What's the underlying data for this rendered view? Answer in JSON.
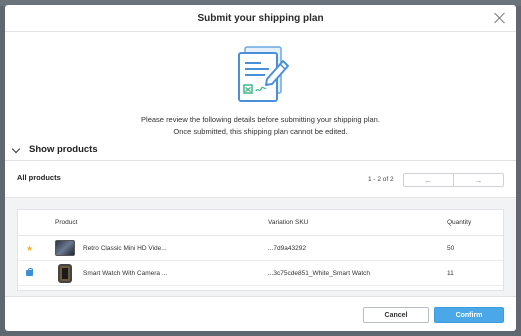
{
  "modal": {
    "title": "Submit your shipping plan",
    "intro_line1": "Please review the following details before submitting your shipping plan.",
    "intro_line2": "Once submitted, this shipping plan cannot be edited."
  },
  "section": {
    "toggle_label": "Show products"
  },
  "products": {
    "heading": "All products",
    "range": "1 - 2 of 2",
    "prev_icon": "arrow-left",
    "next_icon": "arrow-right",
    "columns": [
      "Product",
      "Variation SKU",
      "Quantity"
    ],
    "rows": [
      {
        "status_icon": "star",
        "name": "Retro Classic Mini HD Vide...",
        "sku": "...7d9a43292",
        "quantity": "50"
      },
      {
        "status_icon": "bag",
        "name": "Smart Watch With Camera ...",
        "sku": "...3c75cde851_White_Smart Watch",
        "quantity": "11"
      }
    ]
  },
  "footer": {
    "cancel_label": "Cancel",
    "confirm_label": "Confirm"
  },
  "colors": {
    "accent": "#4aa8e8",
    "star": "#f2b51e",
    "bag": "#3d8fd6"
  }
}
